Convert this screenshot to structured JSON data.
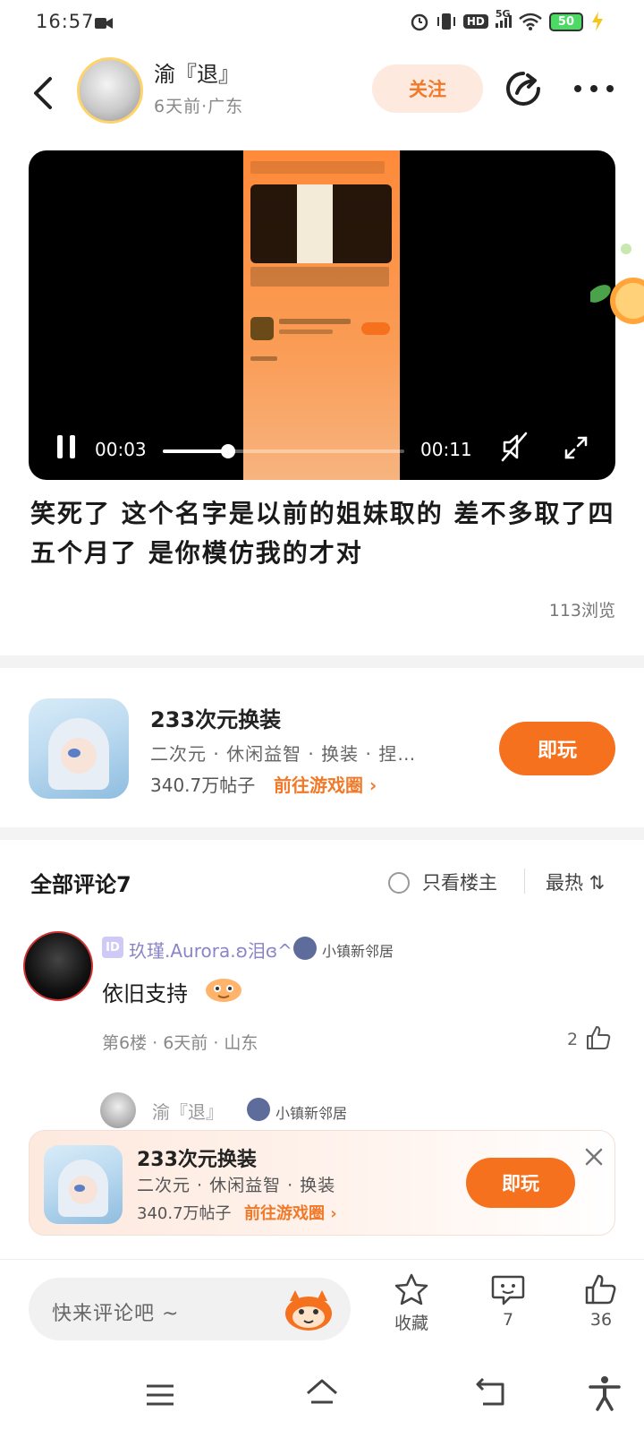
{
  "status_bar": {
    "time": "16:57",
    "network": "5G",
    "hd": "HD",
    "battery": "50"
  },
  "header": {
    "user_name": "渝『退』",
    "user_meta": "6天前·广东",
    "follow_label": "关注"
  },
  "video": {
    "current_time": "00:03",
    "total_time": "00:11",
    "progress": 0.27
  },
  "post": {
    "text": "笑死了  这个名字是以前的姐妹取的  差不多取了四五个月了  是你模仿我的才对",
    "views": "113浏览"
  },
  "game_card": {
    "name": "233次元换装",
    "tags": "二次元 · 休闲益智 · 换装 · 捏…",
    "posts": "340.7万帖子",
    "link_label": "前往游戏圈 ›",
    "play_label": "即玩"
  },
  "comments": {
    "title": "全部评论7",
    "only_owner_label": "只看楼主",
    "sort_label": "最热 ⇅"
  },
  "comment_1": {
    "id_badge": "ID",
    "user_name": "玖瑾.Aurora.ʚ泪ɞ^",
    "badge_text": "小镇新邻居",
    "text": "依旧支持",
    "meta": "第6楼 · 6天前 · 山东",
    "likes": "2"
  },
  "reply_1": {
    "user_name": "渝『退』",
    "badge_text": "小镇新邻居"
  },
  "floating_card": {
    "name": "233次元换装",
    "tags": "二次元 · 休闲益智 · 换装",
    "posts": "340.7万帖子",
    "link_label": "前往游戏圈 ›",
    "play_label": "即玩"
  },
  "bottom_bar": {
    "comment_placeholder": "快来评论吧 ~",
    "favorite_label": "收藏",
    "comment_count": "7",
    "like_count": "36"
  },
  "colors": {
    "accent": "#f5711e",
    "follow_bg": "#fde9de",
    "divider": "#f3f3f3"
  }
}
